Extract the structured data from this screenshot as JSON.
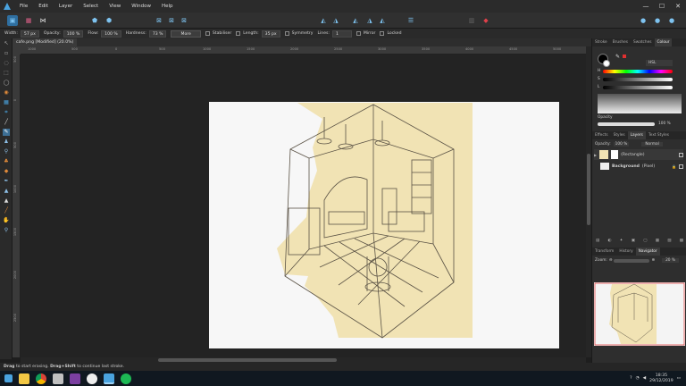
{
  "menubar": {
    "items": [
      "File",
      "Edit",
      "Layer",
      "Select",
      "View",
      "Window",
      "Help"
    ],
    "window_controls": [
      "—",
      "☐",
      "✕"
    ]
  },
  "context_toolbar": {
    "width_label": "Width:",
    "width_value": "57 px",
    "opacity_label": "Opacity:",
    "opacity_value": "100 %",
    "flow_label": "Flow:",
    "flow_value": "100 %",
    "hardness_label": "Hardness:",
    "hardness_value": "73 %",
    "more_label": "More",
    "stabiliser_label": "Stabiliser",
    "length_label": "Length:",
    "length_value": "35 px",
    "symmetry_label": "Symmetry",
    "lines_label": "Lines:",
    "lines_value": "1",
    "mirror_label": "Mirror",
    "locked_label": "Locked"
  },
  "document": {
    "tab_title": "cafe.png [Modified] (20.0%)"
  },
  "rulers": {
    "horizontal": [
      "1000",
      "500",
      "0",
      "500",
      "1000",
      "1500",
      "2000",
      "2500",
      "3000",
      "3500",
      "4000",
      "4500",
      "5000"
    ],
    "vertical": [
      "500",
      "0",
      "500",
      "1000",
      "1500",
      "2000",
      "2500"
    ]
  },
  "statusbar": {
    "bold1": "Drag",
    "text1": "to start erasing.",
    "bold2": "Drag+Shift",
    "text2": "to continue last stroke."
  },
  "panel": {
    "colour_tabs": [
      "Stroke",
      "Brushes",
      "Swatches",
      "Colour"
    ],
    "colour_active": "Colour",
    "colour_mode": "HSL",
    "channel_labels": [
      "H",
      "S",
      "L"
    ],
    "opacity_label": "Opacity",
    "opacity_value": "100 %",
    "layers_tabs": [
      "Effects",
      "Styles",
      "Layers",
      "Text Styles"
    ],
    "layers_active": "Layers",
    "layers_opacity_label": "Opacity:",
    "layers_opacity_value": "100 %",
    "blend_mode": "Normal",
    "layers": [
      {
        "name": "(Rectangle)",
        "bold": false
      },
      {
        "name": "Background",
        "suffix": "(Pixel)",
        "bold": true
      }
    ],
    "nav_tabs": [
      "Transform",
      "History",
      "Navigator"
    ],
    "nav_active": "Navigator",
    "zoom_label": "Zoom:",
    "zoom_value": "20 %"
  },
  "taskbar": {
    "time": "18:35",
    "date": "29/12/2019",
    "icons": [
      "windows-icon",
      "file-explorer-icon",
      "chrome-icon",
      "photo-app-icon",
      "onenote-icon",
      "settings-icon",
      "affinity-photo-icon",
      "spotify-icon"
    ]
  },
  "colors": {
    "accent": "#4aa3df",
    "canvas_bg": "#232323",
    "paper": "#f7f7f7",
    "tape": "#f1e3b4"
  }
}
